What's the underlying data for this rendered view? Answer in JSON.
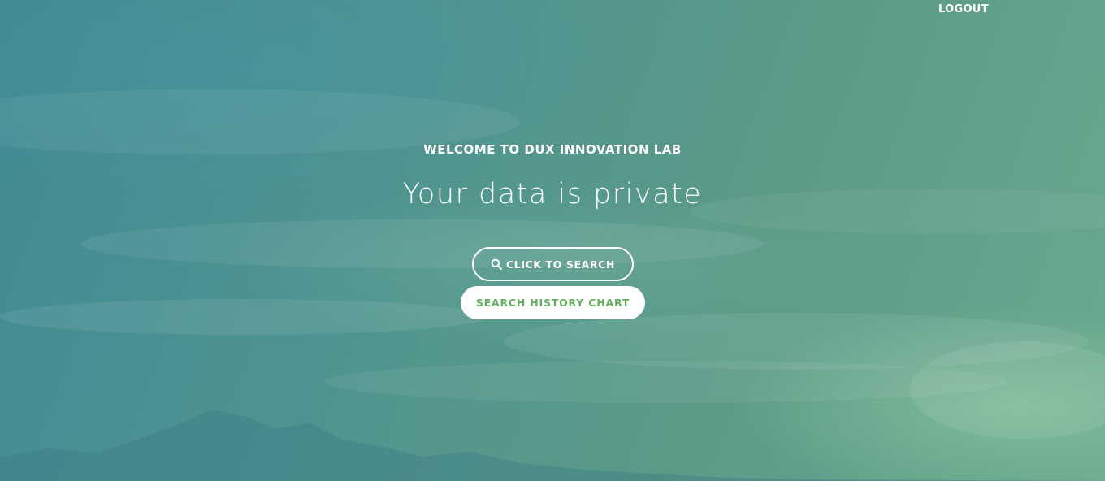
{
  "nav": {
    "logout_label": "LOGOUT"
  },
  "hero": {
    "welcome_text": "WELCOME TO DUX INNOVATION LAB",
    "tagline": "Your data is private",
    "search_button_label": "CLICK TO SEARCH",
    "search_button_icon": "search-icon",
    "history_button_label": "SEARCH HISTORY CHART"
  },
  "colors": {
    "accent_green": "#62b05f",
    "text_white": "#ffffff",
    "background_teal": "#4f9490"
  }
}
